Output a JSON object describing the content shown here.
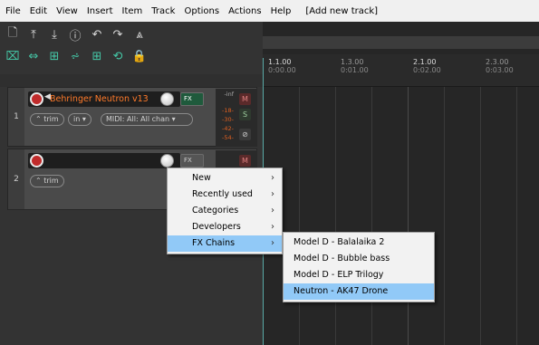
{
  "menu": [
    "File",
    "Edit",
    "View",
    "Insert",
    "Item",
    "Track",
    "Options",
    "Actions",
    "Help",
    "[Add new track]"
  ],
  "ruler": [
    {
      "bar": "1.1.00",
      "time": "0:00.00",
      "major": true
    },
    {
      "bar": "1.3.00",
      "time": "0:01.00",
      "major": false
    },
    {
      "bar": "2.1.00",
      "time": "0:02.00",
      "major": true
    },
    {
      "bar": "2.3.00",
      "time": "0:03.00",
      "major": false
    }
  ],
  "tracks": [
    {
      "number": "1",
      "name": "Behringer Neutron v13",
      "fx_label": "FX",
      "trim_label": "trim",
      "in_label": "in",
      "midi_label": "MIDI: All: All chan",
      "meter_labels": [
        "-inf",
        "-18-",
        "-30-",
        "-42-",
        "-54-"
      ],
      "buttons": [
        "M",
        "S",
        "⊘"
      ]
    },
    {
      "number": "2",
      "name": "",
      "fx_label": "FX",
      "trim_label": "trim",
      "buttons": [
        "M"
      ]
    }
  ],
  "context_menu": {
    "items": [
      {
        "label": "New",
        "has_submenu": true
      },
      {
        "label": "Recently used",
        "has_submenu": true
      },
      {
        "label": "Categories",
        "has_submenu": true
      },
      {
        "label": "Developers",
        "has_submenu": true
      },
      {
        "label": "FX Chains",
        "has_submenu": true,
        "highlighted": true
      }
    ]
  },
  "submenu": {
    "items": [
      {
        "label": "Model D - Balalaika 2"
      },
      {
        "label": "Model D - Bubble bass"
      },
      {
        "label": "Model D - ELP Trilogy"
      },
      {
        "label": "Neutron - AK47 Drone",
        "highlighted": true
      }
    ]
  },
  "colors": {
    "track_name": "#ff7a2a",
    "accent_teal": "#45c9a8",
    "menu_highlight": "#91c9f7",
    "rec_red": "#c02b2b"
  }
}
